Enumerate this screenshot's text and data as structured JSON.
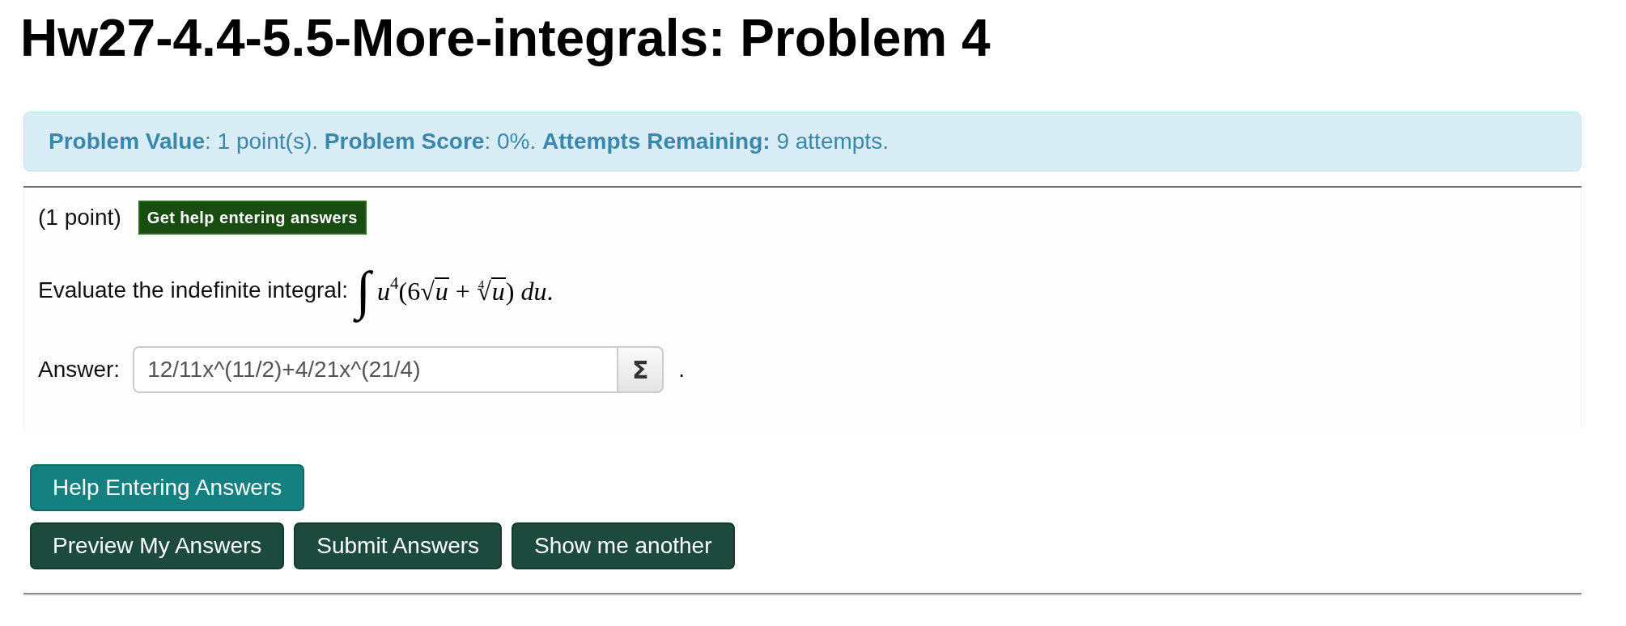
{
  "title": "Hw27-4.4-5.5-More-integrals: Problem 4",
  "info": "**Problem Value**: 1 point(s). **Problem Score**: 0%. **Attempts Remaining:** 9 attempts.",
  "problem": {
    "points": "(1 point)",
    "help_image": "Get help entering answers",
    "prompt": "Evaluate the indefinite integral:",
    "formula": [
      {
        "kind": "integral",
        "text": "∫"
      },
      {
        "kind": "var",
        "text": "u"
      },
      {
        "kind": "sup",
        "text": "4"
      },
      {
        "kind": "plain",
        "text": "(6"
      },
      {
        "kind": "sqrt",
        "sign": "√",
        "text": "u"
      },
      {
        "kind": "plain",
        "text": " + "
      },
      {
        "kind": "sqrt",
        "index": "4",
        "sign": "√",
        "text": "u"
      },
      {
        "kind": "plain",
        "text": ") "
      },
      {
        "kind": "var",
        "text": "du"
      },
      {
        "kind": "plain",
        "text": "."
      }
    ],
    "answer": {
      "label": "Answer:",
      "value": "12/11x^(11/2)+4/21x^(21/4)",
      "editor_button": "Σ",
      "end": "."
    }
  },
  "button_rows": [
    [
      {
        "kind": "help",
        "label": "Help Entering Answers"
      }
    ],
    [
      {
        "kind": "action",
        "label": "Preview My Answers"
      },
      {
        "kind": "action",
        "label": "Submit Answers"
      },
      {
        "kind": "action",
        "label": "Show me another"
      }
    ]
  ]
}
